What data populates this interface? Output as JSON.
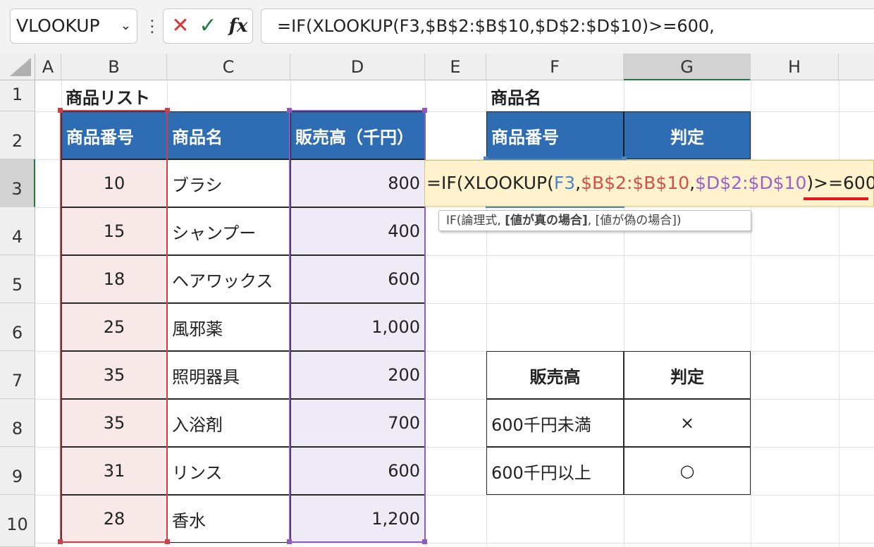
{
  "toolbar": {
    "name_box": "VLOOKUP",
    "more_icon": "vertical-ellipsis",
    "cancel_icon": "✕",
    "enter_icon": "✓",
    "fx_label": "fx",
    "formula": "=IF(XLOOKUP(F3,$B$2:$B$10,$D$2:$D$10)>=600,"
  },
  "columns": [
    "A",
    "B",
    "C",
    "D",
    "E",
    "F",
    "G",
    "H"
  ],
  "rows": [
    "1",
    "2",
    "3",
    "4",
    "5",
    "6",
    "7",
    "8",
    "9",
    "10"
  ],
  "sheet": {
    "title": "商品リスト",
    "table_headers": [
      "商品番号",
      "商品名",
      "販売高（千円）"
    ],
    "products": [
      {
        "num": "10",
        "name": "ブラシ",
        "sales": "800"
      },
      {
        "num": "15",
        "name": "シャンプー",
        "sales": "400"
      },
      {
        "num": "18",
        "name": "ヘアワックス",
        "sales": "600"
      },
      {
        "num": "25",
        "name": "風邪薬",
        "sales": "1,000"
      },
      {
        "num": "35",
        "name": "照明器具",
        "sales": "200"
      },
      {
        "num": "35",
        "name": "入浴剤",
        "sales": "700"
      },
      {
        "num": "31",
        "name": "リンス",
        "sales": "600"
      },
      {
        "num": "28",
        "name": "香水",
        "sales": "1,200"
      }
    ],
    "lookup": {
      "label": "商品名",
      "col_headers": [
        "商品番号",
        "判定"
      ]
    },
    "criteria": {
      "headers": [
        "販売高",
        "判定"
      ],
      "rows": [
        {
          "range": "600千円未満",
          "mark": "×"
        },
        {
          "range": "600千円以上",
          "mark": "○"
        }
      ]
    }
  },
  "editing": {
    "parts": [
      "=IF(XLOOKUP(",
      "F3",
      ",",
      "$B$2:$B$10",
      ",",
      "$D$2:$D$10",
      ")>=600,"
    ],
    "tooltip_pre": "IF(論理式, ",
    "tooltip_bold": "[値が真の場合]",
    "tooltip_post": ", [値が偽の場合])"
  },
  "colors": {
    "header_fill": "#2e6db3",
    "ref1": "#4a86c8",
    "ref2": "#d0504a",
    "ref3": "#9a62c6",
    "edit_fill": "#fff2cc",
    "underline": "#e3141b"
  }
}
